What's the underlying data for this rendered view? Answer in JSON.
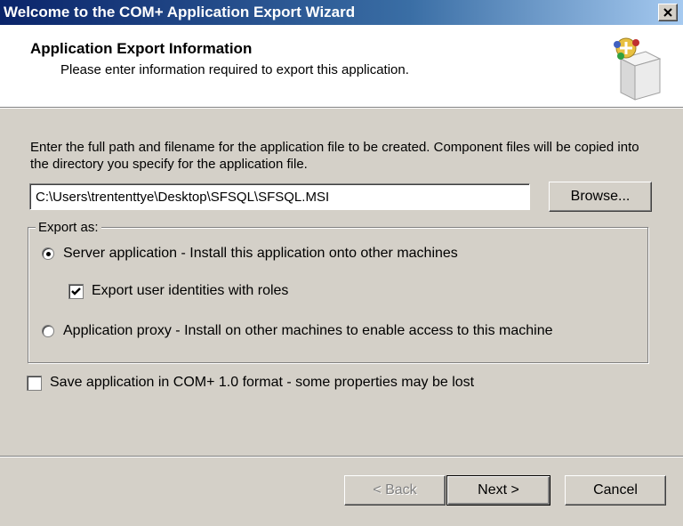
{
  "window": {
    "title": "Welcome to the COM+ Application Export Wizard",
    "close_glyph": "✕"
  },
  "header": {
    "title": "Application Export Information",
    "subtitle": "Please enter information required to export this application.",
    "icon": "com-plus-box-icon"
  },
  "main": {
    "instructions": "Enter the full path and filename for the application file to be created.  Component files will be copied into the directory you specify for the application file.",
    "path_value": "C:\\Users\\trententtye\\Desktop\\SFSQL\\SFSQL.MSI",
    "browse_label": "Browse...",
    "export_group": {
      "label": "Export as:",
      "server_option": "Server application - Install this application onto other machines",
      "server_selected": true,
      "export_identities": "Export user identities with roles",
      "export_identities_checked": true,
      "proxy_option": "Application proxy - Install on other machines to enable access to this machine",
      "proxy_selected": false
    },
    "com10_option": "Save application in COM+ 1.0 format - some properties may be lost",
    "com10_checked": false
  },
  "footer": {
    "back_label": "< Back",
    "next_label": "Next >",
    "cancel_label": "Cancel"
  },
  "colors": {
    "title_bar_start": "#0a246a",
    "dialog_face": "#d4d0c8"
  }
}
